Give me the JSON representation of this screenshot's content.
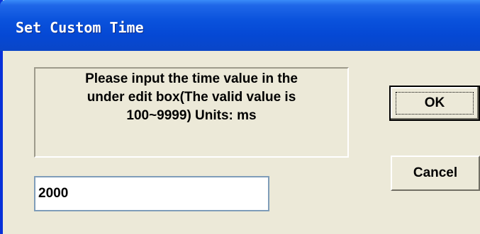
{
  "window": {
    "title": "Set Custom Time"
  },
  "message": {
    "text": "Please input the time value in the\nunder edit box(The valid value is\n100~9999) Units: ms"
  },
  "time_input": {
    "value": "2000"
  },
  "buttons": {
    "ok_label": "OK",
    "cancel_label": "Cancel"
  },
  "colors": {
    "titlebar": "#0548d4",
    "dialog_background": "#ece9d8"
  }
}
